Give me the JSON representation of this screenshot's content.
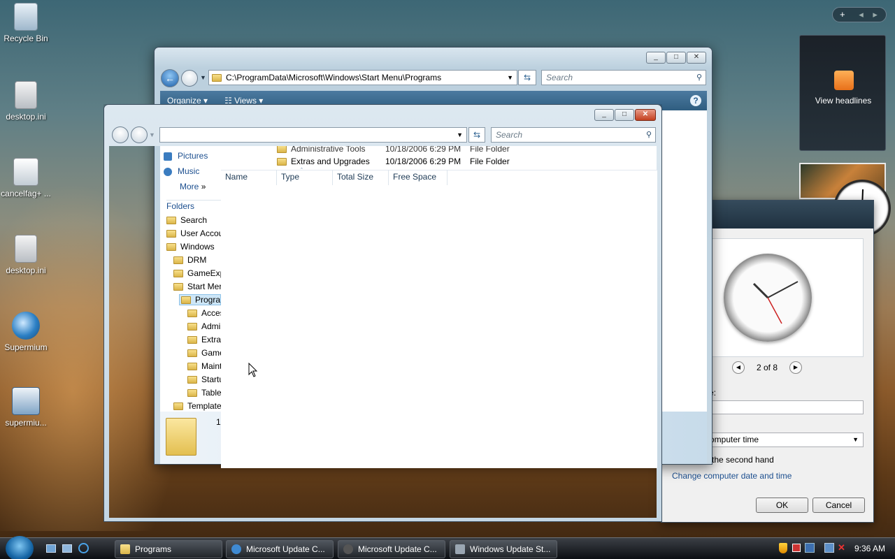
{
  "desktop": {
    "icons": [
      {
        "label": "Recycle Bin",
        "icon": "recycle-bin-icon"
      },
      {
        "label": "desktop.ini",
        "icon": "settings-file-icon"
      },
      {
        "label": "cancelfag+ ...",
        "icon": "settings-file-icon"
      },
      {
        "label": "desktop.ini",
        "icon": "settings-file-icon"
      },
      {
        "label": "Supermium",
        "icon": "supermium-browser-icon"
      },
      {
        "label": "supermiu...",
        "icon": "installer-icon"
      }
    ]
  },
  "back_window": {
    "address": "C:\\ProgramData\\Microsoft\\Windows\\Start Menu\\Programs",
    "search_placeholder": "Search",
    "toolbar": {
      "organize": "Organize",
      "views": "Views"
    },
    "rows": [
      {
        "name": "Administrative Tools",
        "date": "10/18/2006 6:29 PM",
        "type": "File Folder"
      },
      {
        "name": "Extras and Upgrades",
        "date": "10/18/2006 6:29 PM",
        "type": "File Folder"
      }
    ],
    "fav_links": [
      "Pictures",
      "Music",
      "More"
    ],
    "folders_label": "Folders",
    "tree": [
      "Search",
      "User Accou",
      "Windows",
      "DRM",
      "GameExp",
      "Start Mer",
      "Prograr",
      "Acces",
      "Admi",
      "Extras",
      "Game",
      "Maint",
      "Startu",
      "Table",
      "Template"
    ],
    "details_count": "1"
  },
  "front_window": {
    "address": "",
    "search_placeholder": "Search",
    "columns": [
      "Name",
      "Type",
      "Total Size",
      "Free Space"
    ]
  },
  "gadgets": {
    "rss": {
      "label": "View headlines"
    }
  },
  "clock_dialog": {
    "pager": "2 of 8",
    "name_label": "e:",
    "timezone_value": "omputer time",
    "second_hand_label": "the second hand",
    "change_link": "Change computer date and time",
    "ok": "OK",
    "cancel": "Cancel"
  },
  "taskbar": {
    "tasks": [
      {
        "label": "Programs",
        "icon": "folder-icon"
      },
      {
        "label": "Microsoft Update C...",
        "icon": "browser-icon"
      },
      {
        "label": "Microsoft Update C...",
        "icon": "browser-icon"
      },
      {
        "label": "Windows Update St...",
        "icon": "window-icon"
      }
    ],
    "time": "9:36 AM"
  },
  "colors": {
    "accent": "#2f5d80",
    "link": "#1c4f8f",
    "close": "#c3401f"
  }
}
